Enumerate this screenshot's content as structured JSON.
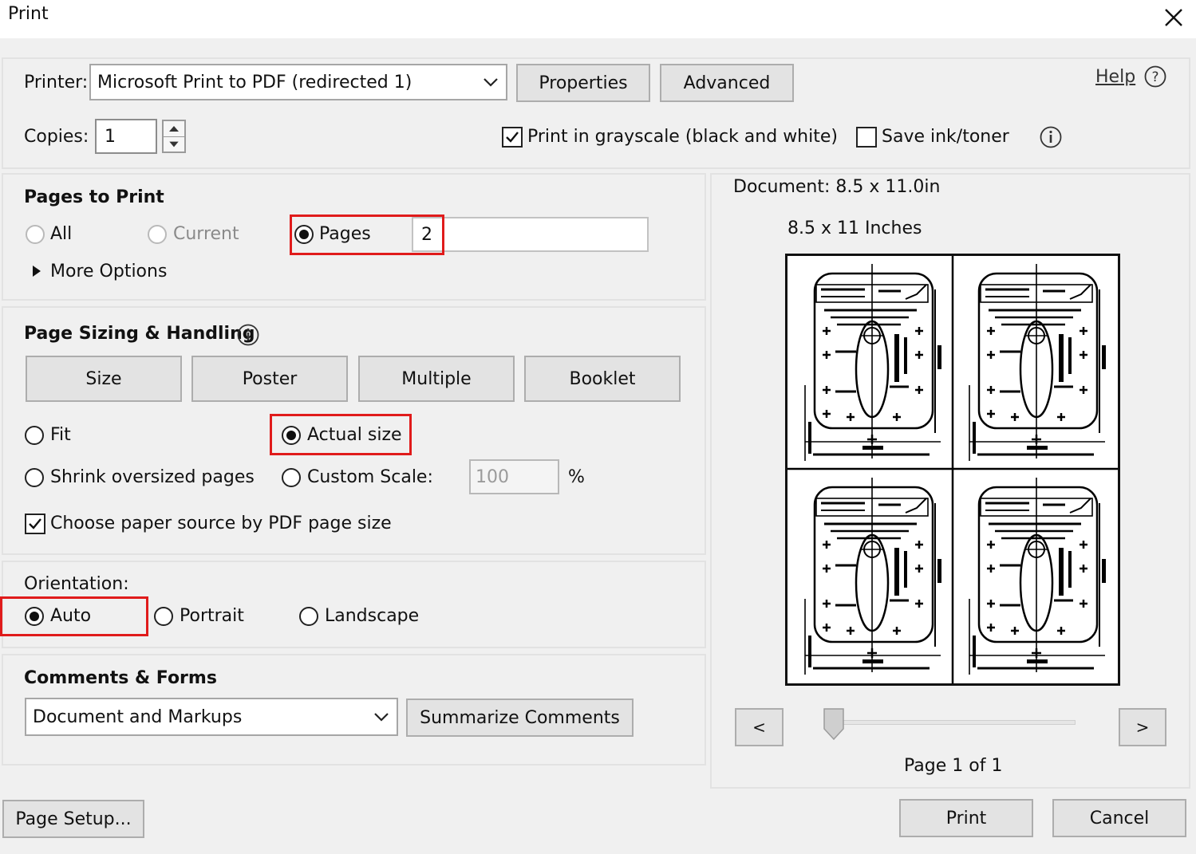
{
  "window": {
    "title": "Print",
    "close_icon": "close-icon"
  },
  "printer": {
    "label": "Printer:",
    "selected": "Microsoft Print to PDF (redirected 1)",
    "properties_label": "Properties",
    "advanced_label": "Advanced",
    "help_label": "Help",
    "help_icon": "question-circle-icon"
  },
  "copies": {
    "label": "Copies:",
    "value": "1"
  },
  "grayscale": {
    "label": "Print in grayscale (black and white)",
    "checked": true
  },
  "save_ink": {
    "label": "Save ink/toner",
    "checked": false,
    "info_icon": "info-icon"
  },
  "pages_to_print": {
    "heading": "Pages to Print",
    "all_label": "All",
    "current_label": "Current",
    "pages_label": "Pages",
    "pages_value": "2",
    "selected": "Pages",
    "more_options_label": "More Options"
  },
  "sizing": {
    "heading": "Page Sizing & Handling",
    "tabs": [
      "Size",
      "Poster",
      "Multiple",
      "Booklet"
    ],
    "fit_label": "Fit",
    "actual_size_label": "Actual size",
    "shrink_label": "Shrink oversized pages",
    "custom_scale_label": "Custom Scale:",
    "custom_scale_value": "100",
    "percent": "%",
    "selected": "Actual size",
    "paper_source_label": "Choose paper source by PDF page size",
    "paper_source_checked": true
  },
  "orientation": {
    "heading": "Orientation:",
    "auto_label": "Auto",
    "portrait_label": "Portrait",
    "landscape_label": "Landscape",
    "selected": "Auto"
  },
  "comments": {
    "heading": "Comments & Forms",
    "selected": "Document and Markups",
    "summarize_label": "Summarize Comments"
  },
  "preview": {
    "document_size": "Document: 8.5 x 11.0in",
    "paper_size": "8.5 x 11 Inches",
    "prev_label": "<",
    "next_label": ">",
    "page_label": "Page 1 of 1",
    "slider_position": 0
  },
  "footer": {
    "page_setup_label": "Page Setup...",
    "print_label": "Print",
    "cancel_label": "Cancel"
  },
  "colors": {
    "highlight": "#e01b1b",
    "window_bg": "#f0f0f0",
    "button_bg": "#e3e3e3"
  }
}
